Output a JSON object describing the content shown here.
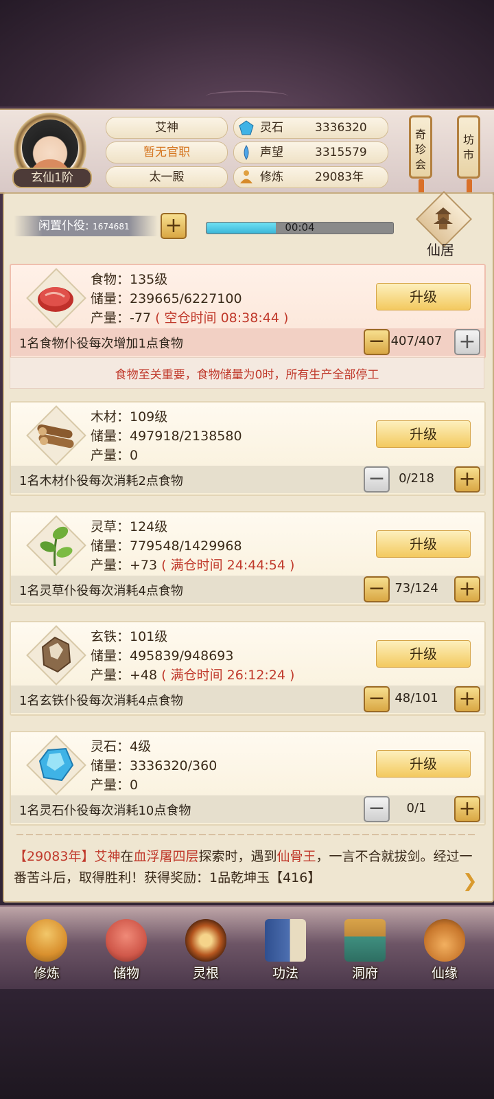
{
  "header": {
    "player_name": "艾神",
    "official_title": "暂无官职",
    "sect": "太一殿",
    "rank_badge": "玄仙1阶",
    "stats": [
      {
        "icon": "spirit-stone-icon",
        "label": "灵石",
        "value": "3336320"
      },
      {
        "icon": "reputation-icon",
        "label": "声望",
        "value": "3315579"
      },
      {
        "icon": "cultivation-icon",
        "label": "修炼",
        "value": "29083年"
      }
    ],
    "side_buttons": [
      {
        "label_lines": [
          "奇",
          "珍",
          "会"
        ]
      },
      {
        "label_lines": [
          "坊",
          "市"
        ]
      }
    ]
  },
  "idle": {
    "label": "闲置仆役:",
    "count": "1674681",
    "timer": "00:04",
    "progress_fraction": 0.37,
    "residence_label": "仙居"
  },
  "resources": [
    {
      "id": "food",
      "icon": "meat-icon",
      "name_line": "食物：135级",
      "storage_line": "储量：239665/6227100",
      "output_prefix": "产量：-77",
      "output_note": "( 空仓时间 08:38:44 )",
      "upgrade_label": "升级",
      "desc": "1名食物仆役每次增加1点食物",
      "count": "407/407",
      "minus_disabled": false,
      "plus_disabled": true
    },
    {
      "id": "wood",
      "icon": "wood-logs-icon",
      "name_line": "木材：109级",
      "storage_line": "储量：497918/2138580",
      "output_prefix": "产量：0",
      "output_note": "",
      "upgrade_label": "升级",
      "desc": "1名木材仆役每次消耗2点食物",
      "count": "0/218",
      "minus_disabled": true,
      "plus_disabled": false
    },
    {
      "id": "herb",
      "icon": "herb-icon",
      "name_line": "灵草：124级",
      "storage_line": "储量：779548/1429968",
      "output_prefix": "产量：+73",
      "output_note": "( 满仓时间 24:44:54 )",
      "upgrade_label": "升级",
      "desc": "1名灵草仆役每次消耗4点食物",
      "count": "73/124",
      "minus_disabled": false,
      "plus_disabled": false
    },
    {
      "id": "iron",
      "icon": "ore-icon",
      "name_line": "玄铁：101级",
      "storage_line": "储量：495839/948693",
      "output_prefix": "产量：+48",
      "output_note": "( 满仓时间 26:12:24 )",
      "upgrade_label": "升级",
      "desc": "1名玄铁仆役每次消耗4点食物",
      "count": "48/101",
      "minus_disabled": false,
      "plus_disabled": false
    },
    {
      "id": "stone",
      "icon": "crystal-icon",
      "name_line": "灵石：4级",
      "storage_line": "储量：3336320/360",
      "output_prefix": "产量：0",
      "output_note": "",
      "upgrade_label": "升级",
      "desc": "1名灵石仆役每次消耗10点食物",
      "count": "0/1",
      "minus_disabled": true,
      "plus_disabled": false
    }
  ],
  "food_warning": "食物至关重要，食物储量为0时，所有生产全部停工",
  "log": {
    "year": "【29083年】",
    "actor": "艾神",
    "t1": "在",
    "place": "血浮屠四层",
    "t2": "探索时，遇到",
    "enemy": "仙骨王",
    "t3": "，一言不合就拔剑。经过一番苦斗后，取得胜利！获得奖励：1品乾坤玉【416】"
  },
  "nav": [
    {
      "label": "修炼",
      "icon": "cultivate-icon",
      "color": "#d9902e"
    },
    {
      "label": "储物",
      "icon": "storage-bag-icon",
      "color": "#d0584a"
    },
    {
      "label": "灵根",
      "icon": "spirit-root-icon",
      "color": "#b5561f"
    },
    {
      "label": "功法",
      "icon": "technique-book-icon",
      "color": "#4d6fb0"
    },
    {
      "label": "洞府",
      "icon": "cave-mansion-icon",
      "color": "#c08a3a"
    },
    {
      "label": "仙缘",
      "icon": "gourd-icon",
      "color": "#c9782d"
    }
  ]
}
